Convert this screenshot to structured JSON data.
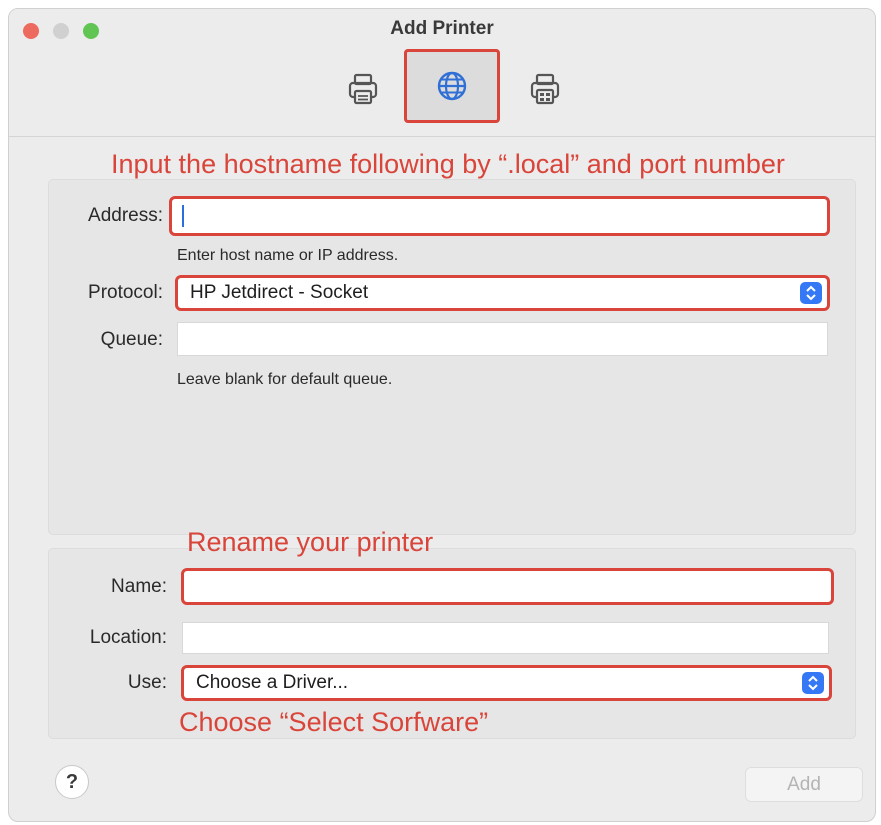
{
  "window": {
    "title": "Add Printer"
  },
  "toolbar": {
    "items": [
      {
        "name": "default",
        "icon": "printer-icon"
      },
      {
        "name": "ip",
        "icon": "globe-icon",
        "selected": true
      },
      {
        "name": "windows",
        "icon": "windows-printer-icon"
      }
    ]
  },
  "annotations": {
    "address_tip": "Input the hostname following by “.local” and port number",
    "name_tip": "Rename your printer",
    "driver_tip": "Choose “Select Sorfware”"
  },
  "form": {
    "address_label": "Address:",
    "address_value": "",
    "address_hint": "Enter host name or IP address.",
    "protocol_label": "Protocol:",
    "protocol_value": "HP Jetdirect - Socket",
    "queue_label": "Queue:",
    "queue_value": "",
    "queue_hint": "Leave blank for default queue.",
    "name_label": "Name:",
    "name_value": "",
    "location_label": "Location:",
    "location_value": "",
    "use_label": "Use:",
    "use_value": "Choose a Driver..."
  },
  "footer": {
    "help_label": "?",
    "add_label": "Add"
  },
  "colors": {
    "highlight": "#d9453a",
    "accent": "#3478f6"
  }
}
